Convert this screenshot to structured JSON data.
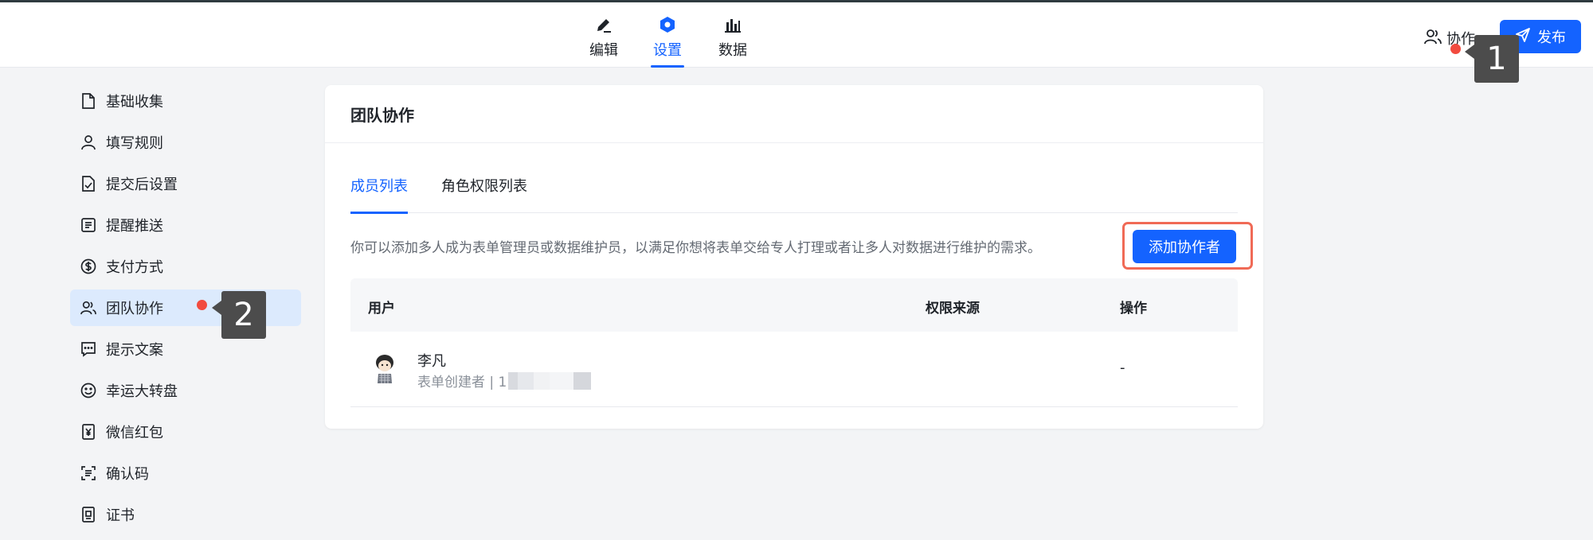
{
  "nav": {
    "tabs": [
      {
        "label": "编辑",
        "icon": "pencil-icon"
      },
      {
        "label": "设置",
        "icon": "hexagon-settings-icon",
        "active": true
      },
      {
        "label": "数据",
        "icon": "bar-chart-icon"
      }
    ],
    "collab_label": "协作",
    "publish_label": "发布"
  },
  "annotations": {
    "step1": "1",
    "step2": "2"
  },
  "sidebar": {
    "items": [
      {
        "label": "基础收集",
        "icon": "document-icon"
      },
      {
        "label": "填写规则",
        "icon": "user-icon"
      },
      {
        "label": "提交后设置",
        "icon": "file-check-icon"
      },
      {
        "label": "提醒推送",
        "icon": "message-lines-icon"
      },
      {
        "label": "支付方式",
        "icon": "dollar-circle-icon"
      },
      {
        "label": "团队协作",
        "icon": "users-icon",
        "active": true
      },
      {
        "label": "提示文案",
        "icon": "chat-dots-icon"
      },
      {
        "label": "幸运大转盘",
        "icon": "smile-icon"
      },
      {
        "label": "微信红包",
        "icon": "yen-envelope-icon"
      },
      {
        "label": "确认码",
        "icon": "scan-code-icon"
      },
      {
        "label": "证书",
        "icon": "certificate-icon"
      }
    ]
  },
  "card": {
    "title": "团队协作",
    "tabs": [
      "成员列表",
      "角色权限列表"
    ],
    "description": "你可以添加多人成为表单管理员或数据维护员，以满足你想将表单交给专人打理或者让多人对数据进行维护的需求。",
    "add_button": "添加协作者",
    "table": {
      "headers": [
        "用户",
        "权限来源",
        "操作"
      ],
      "rows": [
        {
          "name": "李凡",
          "subtitle": "表单创建者 | 1",
          "source": "",
          "action": "-"
        }
      ]
    }
  },
  "colors": {
    "accent": "#1463ff",
    "highlight": "#f06a56",
    "badge": "#4c4c4c",
    "dot": "#f24b3f"
  }
}
